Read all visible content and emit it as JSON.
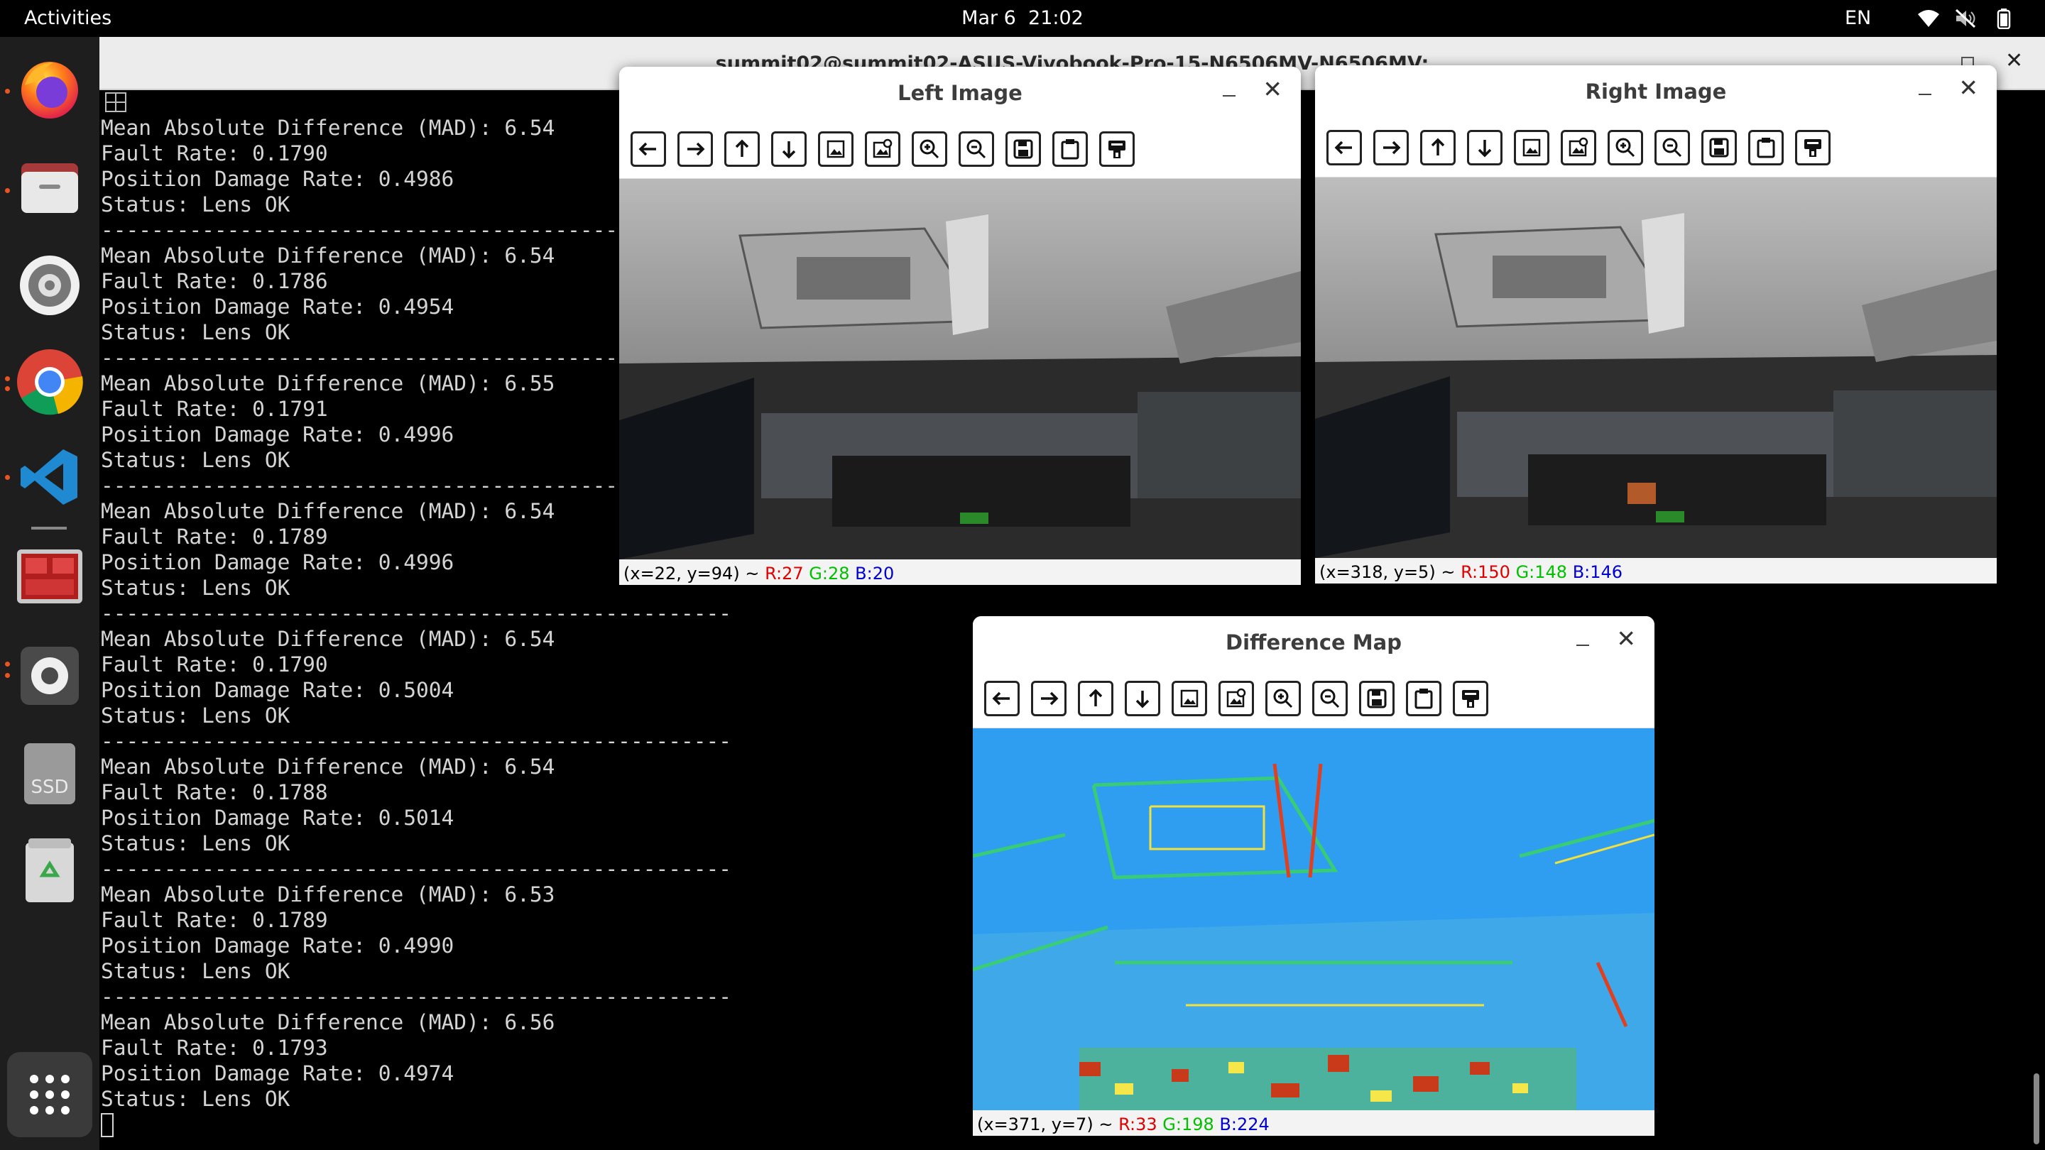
{
  "topbar": {
    "activities": "Activities",
    "date": "Mar 6",
    "time": "21:02",
    "lang": "EN",
    "icons": [
      "wifi-icon",
      "volume-muted-icon",
      "battery-icon"
    ]
  },
  "dock": {
    "apps": [
      {
        "name": "Firefox",
        "icon": "firefox-icon",
        "running": true
      },
      {
        "name": "Files",
        "icon": "files-icon",
        "running": true
      },
      {
        "name": "Settings Tool",
        "icon": "settings-gear-icon",
        "running": false
      },
      {
        "name": "Chrome",
        "icon": "chrome-icon",
        "running": true
      },
      {
        "name": "VS Code",
        "icon": "vscode-icon",
        "running": true
      },
      {
        "name": "Monitor",
        "icon": "system-monitor-icon",
        "running": false
      },
      {
        "name": "Settings",
        "icon": "settings-icon",
        "running": true
      },
      {
        "name": "SSD",
        "icon": "drive-icon",
        "label": "SSD",
        "running": false
      },
      {
        "name": "Trash",
        "icon": "trash-icon",
        "running": false
      }
    ],
    "apps_grid_icon": "apps-grid-icon"
  },
  "terminal": {
    "title": "summit02@summit02-ASUS-Vivobook-Pro-15-N6506MV-N6506MV:",
    "lines": [
      "Mean Absolute Difference (MAD): 6.54",
      "Fault Rate: 0.1790",
      "Position Damage Rate: 0.4986",
      "Status: Lens OK",
      "--------------------------------------------------",
      "Mean Absolute Difference (MAD): 6.54",
      "Fault Rate: 0.1786",
      "Position Damage Rate: 0.4954",
      "Status: Lens OK",
      "--------------------------------------------------",
      "Mean Absolute Difference (MAD): 6.55",
      "Fault Rate: 0.1791",
      "Position Damage Rate: 0.4996",
      "Status: Lens OK",
      "--------------------------------------------------",
      "Mean Absolute Difference (MAD): 6.54",
      "Fault Rate: 0.1789",
      "Position Damage Rate: 0.4996",
      "Status: Lens OK",
      "--------------------------------------------------",
      "Mean Absolute Difference (MAD): 6.54",
      "Fault Rate: 0.1790",
      "Position Damage Rate: 0.5004",
      "Status: Lens OK",
      "--------------------------------------------------",
      "Mean Absolute Difference (MAD): 6.54",
      "Fault Rate: 0.1788",
      "Position Damage Rate: 0.5014",
      "Status: Lens OK",
      "--------------------------------------------------",
      "Mean Absolute Difference (MAD): 6.53",
      "Fault Rate: 0.1789",
      "Position Damage Rate: 0.4990",
      "Status: Lens OK",
      "--------------------------------------------------",
      "Mean Absolute Difference (MAD): 6.56",
      "Fault Rate: 0.1793",
      "Position Damage Rate: 0.4974",
      "Status: Lens OK"
    ]
  },
  "toolbar_icons": [
    "pan-left-icon",
    "pan-right-icon",
    "pan-up-icon",
    "pan-down-icon",
    "zoom-fit-icon",
    "zoom-original-icon",
    "zoom-in-icon",
    "zoom-out-icon",
    "save-icon",
    "copy-clipboard-icon",
    "properties-icon"
  ],
  "windows": {
    "left": {
      "title": "Left Image",
      "status_pos": "(x=22, y=94) ~",
      "status_r": "R:27",
      "status_g": "G:28",
      "status_b": "B:20"
    },
    "right": {
      "title": "Right Image",
      "status_pos": "(x=318, y=5) ~",
      "status_r": "R:150",
      "status_g": "G:148",
      "status_b": "B:146"
    },
    "diff": {
      "title": "Difference Map",
      "status_pos": "(x=371, y=7) ~",
      "status_r": "R:33",
      "status_g": "G:198",
      "status_b": "B:224"
    }
  },
  "colors": {
    "dock_bg": "#1e1e1e",
    "accent_dot": "#e95420",
    "diff_base": "#2b9cf0"
  }
}
